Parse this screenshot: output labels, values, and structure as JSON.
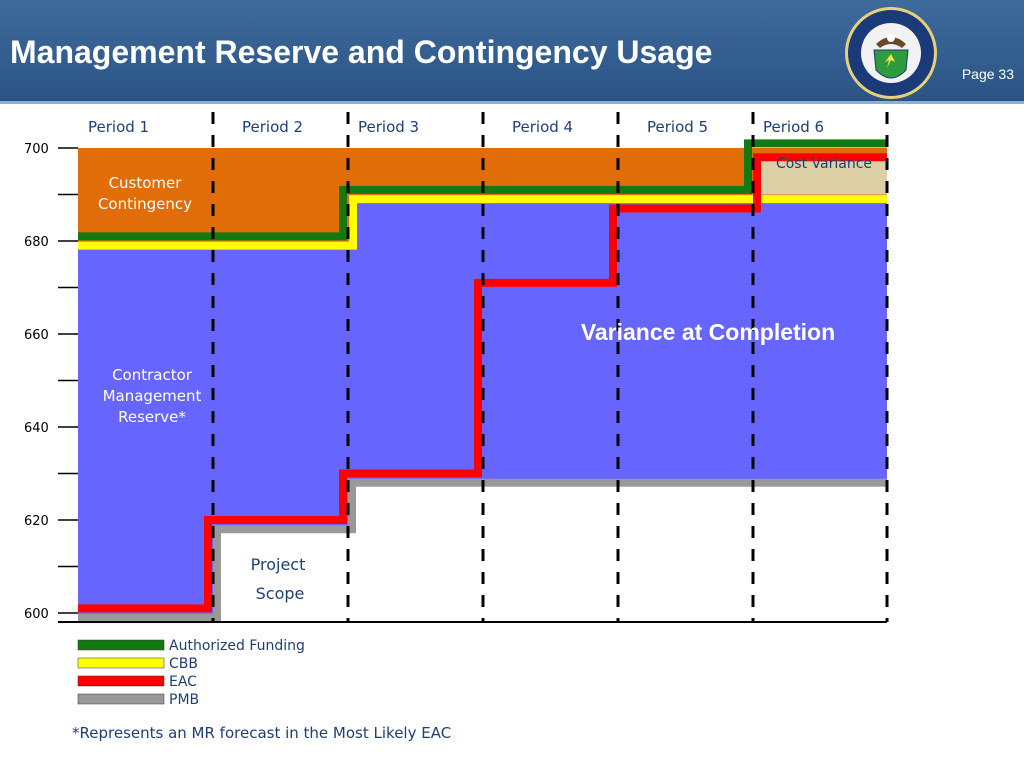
{
  "header": {
    "title": "Management Reserve and Contingency Usage",
    "page_label": "Page 33",
    "seal_icon": "department-of-energy-seal-icon",
    "seal_text_top": "DEPARTMENT OF ENERGY",
    "seal_text_bottom": "UNITED STATES OF AMERICA"
  },
  "colors": {
    "contingency": "#e06d07",
    "reserve": "#6666ff",
    "cost_variance": "#dccfa6",
    "authorized_funding": "#137a13",
    "cbb": "#ffff00",
    "eac": "#ff0000",
    "pmb": "#999999",
    "label_text": "#1f3f73"
  },
  "chart_data": {
    "type": "area",
    "x": [
      "Period 1",
      "Period 2",
      "Period 3",
      "Period 4",
      "Period 5",
      "Period 6"
    ],
    "ylim": [
      600,
      700
    ],
    "y_ticks": [
      600,
      620,
      640,
      660,
      680,
      700
    ],
    "grid": false,
    "legend_position": "bottom-left",
    "series": [
      {
        "name": "Authorized Funding",
        "values": [
          681,
          681,
          691,
          691,
          691,
          701
        ]
      },
      {
        "name": "CBB",
        "values": [
          679,
          679,
          689,
          689,
          689,
          689
        ]
      },
      {
        "name": "EAC",
        "values": [
          601,
          620,
          630,
          671,
          687,
          698
        ]
      },
      {
        "name": "PMB",
        "values": [
          599,
          618,
          628,
          628,
          628,
          628
        ]
      }
    ],
    "annotations": {
      "customer_contingency": "Customer Contingency",
      "management_reserve": "Contractor Management Reserve*",
      "project_scope": "Project Scope",
      "cost_variance": "Cost Variance",
      "variance_at_completion": "Variance at Completion"
    },
    "footnote": "*Represents an MR forecast in the Most Likely EAC"
  }
}
